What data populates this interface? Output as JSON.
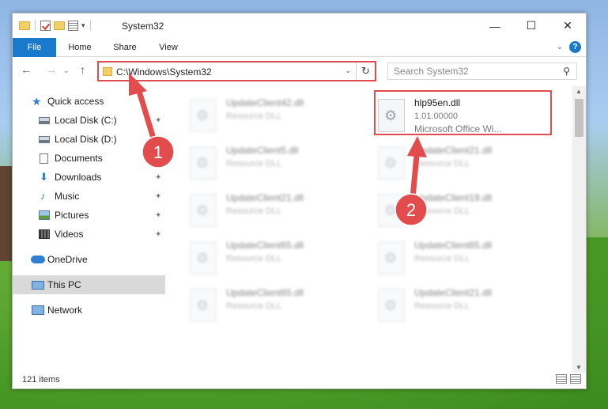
{
  "window": {
    "title": "System32",
    "minimize": "—",
    "maximize": "☐",
    "close": "✕"
  },
  "ribbon": {
    "tabs": [
      "File",
      "Home",
      "Share",
      "View"
    ]
  },
  "nav": {
    "address": "C:\\Windows\\System32",
    "search_placeholder": "Search System32"
  },
  "sidebar": {
    "items": [
      {
        "label": "Quick access",
        "icon": "star-icon"
      },
      {
        "label": "Local Disk (C:)",
        "icon": "drive-icon",
        "pinned": true
      },
      {
        "label": "Local Disk (D:)",
        "icon": "drive-icon"
      },
      {
        "label": "Documents",
        "icon": "document-icon",
        "pinned": true
      },
      {
        "label": "Downloads",
        "icon": "download-icon",
        "pinned": true
      },
      {
        "label": "Music",
        "icon": "music-icon",
        "pinned": true
      },
      {
        "label": "Pictures",
        "icon": "picture-icon",
        "pinned": true
      },
      {
        "label": "Videos",
        "icon": "video-icon",
        "pinned": true
      },
      {
        "label": "OneDrive",
        "icon": "cloud-icon"
      },
      {
        "label": "This PC",
        "icon": "computer-icon",
        "selected": true
      },
      {
        "label": "Network",
        "icon": "network-icon"
      }
    ]
  },
  "files": [
    {
      "name": "UpdateClient42.dll",
      "sub1": "Resource DLL",
      "blurred": true
    },
    {
      "name": "hlp95en.dll",
      "sub1": "1.01.00000",
      "sub2": "Microsoft Office Wi...",
      "blurred": false
    },
    {
      "name": "UpdateClient5.dll",
      "sub1": "Resource DLL",
      "blurred": true
    },
    {
      "name": "UpdateClient21.dll",
      "sub1": "Resource DLL",
      "blurred": true
    },
    {
      "name": "UpdateClient21.dll",
      "sub1": "Resource DLL",
      "blurred": true
    },
    {
      "name": "UpdateClient19.dll",
      "sub1": "Resource DLL",
      "blurred": true
    },
    {
      "name": "UpdateClient65.dll",
      "sub1": "Resource DLL",
      "blurred": true
    },
    {
      "name": "UpdateClient65.dll",
      "sub1": "Resource DLL",
      "blurred": true
    },
    {
      "name": "UpdateClient65.dll",
      "sub1": "Resource DLL",
      "blurred": true
    },
    {
      "name": "UpdateClient21.dll",
      "sub1": "Resource DLL",
      "blurred": true
    }
  ],
  "status": {
    "items": "121 items"
  },
  "annotations": {
    "step1": "1",
    "step2": "2",
    "color": "#e24c4c"
  },
  "colors": {
    "accent": "#1979ca",
    "highlight": "#e24c4c"
  }
}
